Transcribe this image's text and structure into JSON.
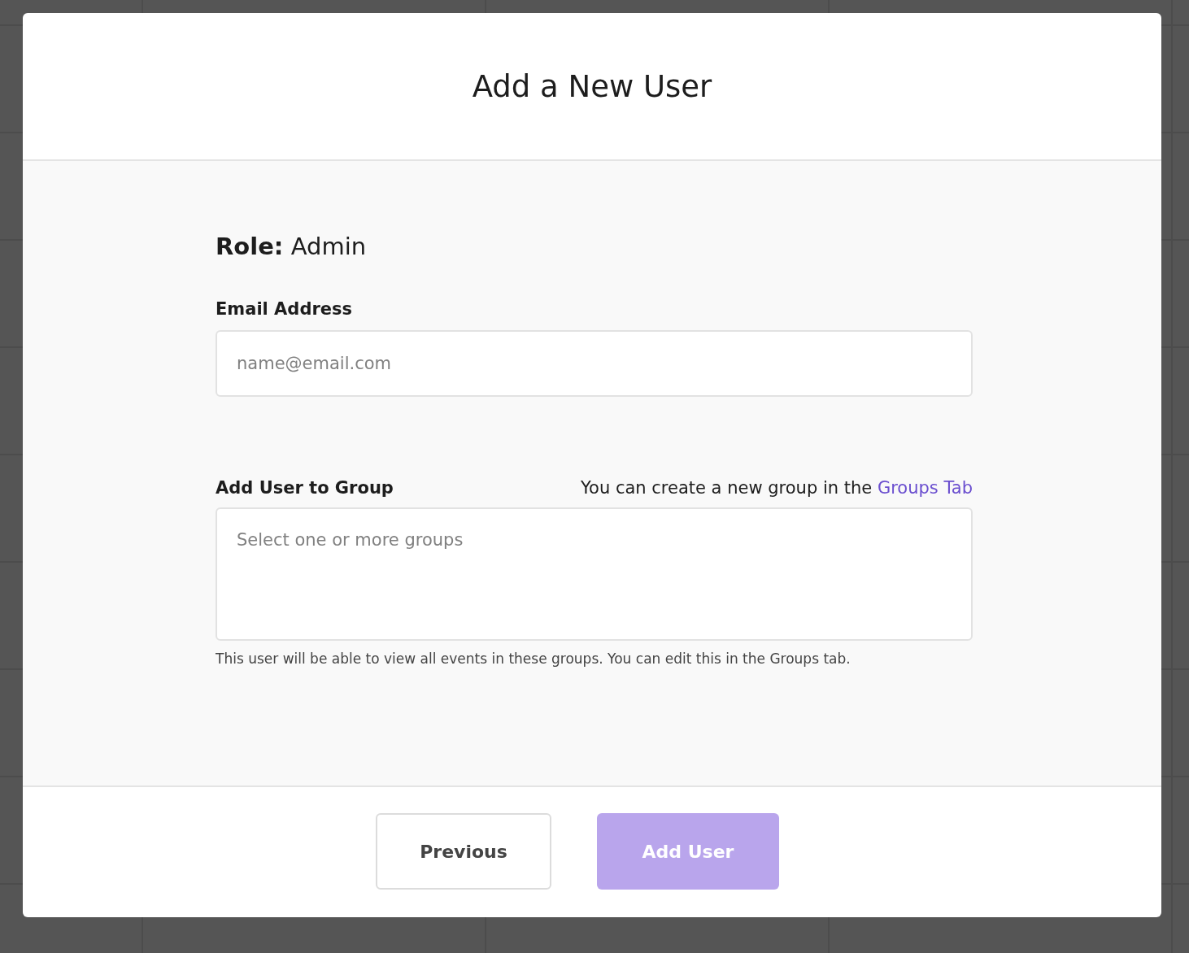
{
  "dialog": {
    "title": "Add a New User"
  },
  "role": {
    "label": "Role:",
    "value": "Admin"
  },
  "email": {
    "label": "Email Address",
    "placeholder": "name@email.com"
  },
  "group": {
    "label": "Add User to Group",
    "hint": "You can create a new group in the",
    "link": "Groups Tab",
    "placeholder": "Select one or more groups",
    "help": "This user will be able to view all events in these groups. You can edit this in the Groups tab."
  },
  "buttons": [
    {
      "label": "Previous",
      "kind": "secondary",
      "disabled": false
    },
    {
      "label": "Add User",
      "kind": "primary",
      "disabled": true
    }
  ]
}
